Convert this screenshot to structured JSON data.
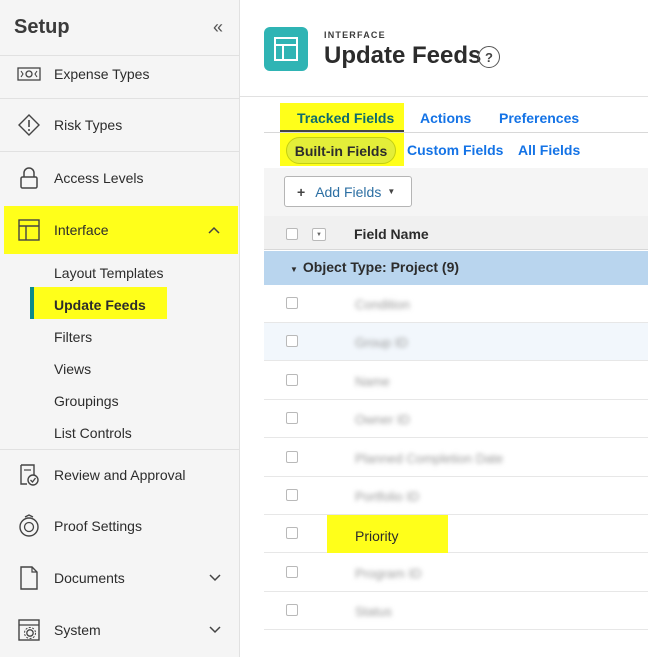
{
  "sidebar": {
    "title": "Setup",
    "collapse_icon": "double-chevron-left-icon",
    "items": [
      {
        "label": "Expense Types",
        "icon": "money-icon"
      },
      {
        "label": "Risk Types",
        "icon": "diamond-alert-icon"
      },
      {
        "label": "Access Levels",
        "icon": "lock-icon"
      },
      {
        "label": "Interface",
        "icon": "layout-icon",
        "expanded": true
      },
      {
        "label": "Review and Approval",
        "icon": "review-icon"
      },
      {
        "label": "Proof Settings",
        "icon": "proof-icon"
      },
      {
        "label": "Documents",
        "icon": "document-icon"
      },
      {
        "label": "System",
        "icon": "system-icon"
      }
    ],
    "sub_items": [
      "Layout Templates",
      "Update Feeds",
      "Filters",
      "Views",
      "Groupings",
      "List Controls"
    ],
    "active_sub_item": "Update Feeds"
  },
  "header": {
    "eyebrow": "INTERFACE",
    "title": "Update Feeds",
    "help_label": "?"
  },
  "tabs": [
    "Tracked Fields",
    "Actions",
    "Preferences"
  ],
  "active_tab": "Tracked Fields",
  "subtabs": [
    "Built-in Fields",
    "Custom Fields",
    "All Fields"
  ],
  "active_subtab": "Built-in Fields",
  "toolbar": {
    "add_label": "Add Fields",
    "plus": "+"
  },
  "table": {
    "column_header": "Field Name",
    "group_label": "Object Type: Project (9)",
    "rows": [
      {
        "label": "Condition",
        "blurred": true
      },
      {
        "label": "Group ID",
        "blurred": true
      },
      {
        "label": "Name",
        "blurred": true
      },
      {
        "label": "Owner ID",
        "blurred": true
      },
      {
        "label": "Planned Completion Date",
        "blurred": true
      },
      {
        "label": "Portfolio ID",
        "blurred": true
      },
      {
        "label": "Priority",
        "blurred": false
      },
      {
        "label": "Program ID",
        "blurred": true
      },
      {
        "label": "Status",
        "blurred": true
      }
    ]
  },
  "colors": {
    "highlight": "#ffff1a",
    "accent": "#1473e6",
    "teal": "#2fb4b4",
    "group_bg": "#b9d5ee"
  }
}
